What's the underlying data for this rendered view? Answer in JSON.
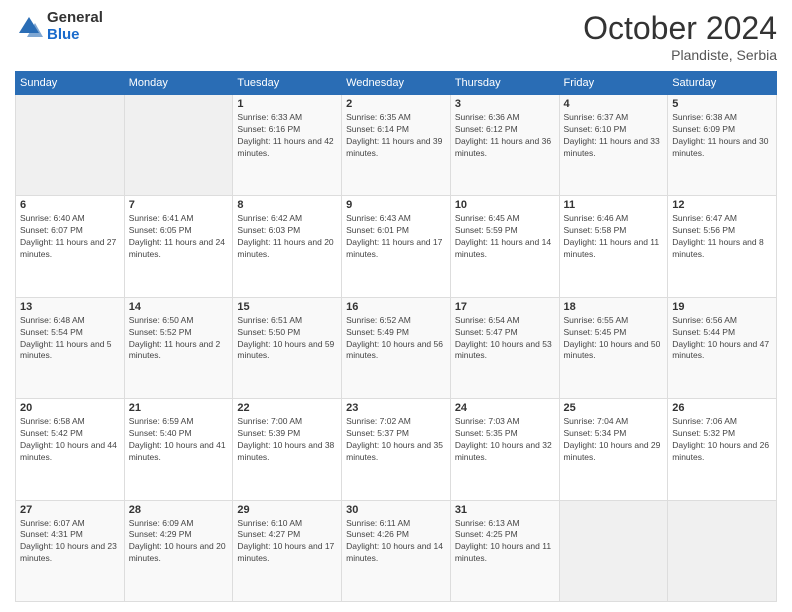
{
  "logo": {
    "general": "General",
    "blue": "Blue"
  },
  "header": {
    "month": "October 2024",
    "location": "Plandiste, Serbia"
  },
  "weekdays": [
    "Sunday",
    "Monday",
    "Tuesday",
    "Wednesday",
    "Thursday",
    "Friday",
    "Saturday"
  ],
  "weeks": [
    [
      {
        "day": "",
        "info": ""
      },
      {
        "day": "",
        "info": ""
      },
      {
        "day": "1",
        "info": "Sunrise: 6:33 AM\nSunset: 6:16 PM\nDaylight: 11 hours and 42 minutes."
      },
      {
        "day": "2",
        "info": "Sunrise: 6:35 AM\nSunset: 6:14 PM\nDaylight: 11 hours and 39 minutes."
      },
      {
        "day": "3",
        "info": "Sunrise: 6:36 AM\nSunset: 6:12 PM\nDaylight: 11 hours and 36 minutes."
      },
      {
        "day": "4",
        "info": "Sunrise: 6:37 AM\nSunset: 6:10 PM\nDaylight: 11 hours and 33 minutes."
      },
      {
        "day": "5",
        "info": "Sunrise: 6:38 AM\nSunset: 6:09 PM\nDaylight: 11 hours and 30 minutes."
      }
    ],
    [
      {
        "day": "6",
        "info": "Sunrise: 6:40 AM\nSunset: 6:07 PM\nDaylight: 11 hours and 27 minutes."
      },
      {
        "day": "7",
        "info": "Sunrise: 6:41 AM\nSunset: 6:05 PM\nDaylight: 11 hours and 24 minutes."
      },
      {
        "day": "8",
        "info": "Sunrise: 6:42 AM\nSunset: 6:03 PM\nDaylight: 11 hours and 20 minutes."
      },
      {
        "day": "9",
        "info": "Sunrise: 6:43 AM\nSunset: 6:01 PM\nDaylight: 11 hours and 17 minutes."
      },
      {
        "day": "10",
        "info": "Sunrise: 6:45 AM\nSunset: 5:59 PM\nDaylight: 11 hours and 14 minutes."
      },
      {
        "day": "11",
        "info": "Sunrise: 6:46 AM\nSunset: 5:58 PM\nDaylight: 11 hours and 11 minutes."
      },
      {
        "day": "12",
        "info": "Sunrise: 6:47 AM\nSunset: 5:56 PM\nDaylight: 11 hours and 8 minutes."
      }
    ],
    [
      {
        "day": "13",
        "info": "Sunrise: 6:48 AM\nSunset: 5:54 PM\nDaylight: 11 hours and 5 minutes."
      },
      {
        "day": "14",
        "info": "Sunrise: 6:50 AM\nSunset: 5:52 PM\nDaylight: 11 hours and 2 minutes."
      },
      {
        "day": "15",
        "info": "Sunrise: 6:51 AM\nSunset: 5:50 PM\nDaylight: 10 hours and 59 minutes."
      },
      {
        "day": "16",
        "info": "Sunrise: 6:52 AM\nSunset: 5:49 PM\nDaylight: 10 hours and 56 minutes."
      },
      {
        "day": "17",
        "info": "Sunrise: 6:54 AM\nSunset: 5:47 PM\nDaylight: 10 hours and 53 minutes."
      },
      {
        "day": "18",
        "info": "Sunrise: 6:55 AM\nSunset: 5:45 PM\nDaylight: 10 hours and 50 minutes."
      },
      {
        "day": "19",
        "info": "Sunrise: 6:56 AM\nSunset: 5:44 PM\nDaylight: 10 hours and 47 minutes."
      }
    ],
    [
      {
        "day": "20",
        "info": "Sunrise: 6:58 AM\nSunset: 5:42 PM\nDaylight: 10 hours and 44 minutes."
      },
      {
        "day": "21",
        "info": "Sunrise: 6:59 AM\nSunset: 5:40 PM\nDaylight: 10 hours and 41 minutes."
      },
      {
        "day": "22",
        "info": "Sunrise: 7:00 AM\nSunset: 5:39 PM\nDaylight: 10 hours and 38 minutes."
      },
      {
        "day": "23",
        "info": "Sunrise: 7:02 AM\nSunset: 5:37 PM\nDaylight: 10 hours and 35 minutes."
      },
      {
        "day": "24",
        "info": "Sunrise: 7:03 AM\nSunset: 5:35 PM\nDaylight: 10 hours and 32 minutes."
      },
      {
        "day": "25",
        "info": "Sunrise: 7:04 AM\nSunset: 5:34 PM\nDaylight: 10 hours and 29 minutes."
      },
      {
        "day": "26",
        "info": "Sunrise: 7:06 AM\nSunset: 5:32 PM\nDaylight: 10 hours and 26 minutes."
      }
    ],
    [
      {
        "day": "27",
        "info": "Sunrise: 6:07 AM\nSunset: 4:31 PM\nDaylight: 10 hours and 23 minutes."
      },
      {
        "day": "28",
        "info": "Sunrise: 6:09 AM\nSunset: 4:29 PM\nDaylight: 10 hours and 20 minutes."
      },
      {
        "day": "29",
        "info": "Sunrise: 6:10 AM\nSunset: 4:27 PM\nDaylight: 10 hours and 17 minutes."
      },
      {
        "day": "30",
        "info": "Sunrise: 6:11 AM\nSunset: 4:26 PM\nDaylight: 10 hours and 14 minutes."
      },
      {
        "day": "31",
        "info": "Sunrise: 6:13 AM\nSunset: 4:25 PM\nDaylight: 10 hours and 11 minutes."
      },
      {
        "day": "",
        "info": ""
      },
      {
        "day": "",
        "info": ""
      }
    ]
  ]
}
